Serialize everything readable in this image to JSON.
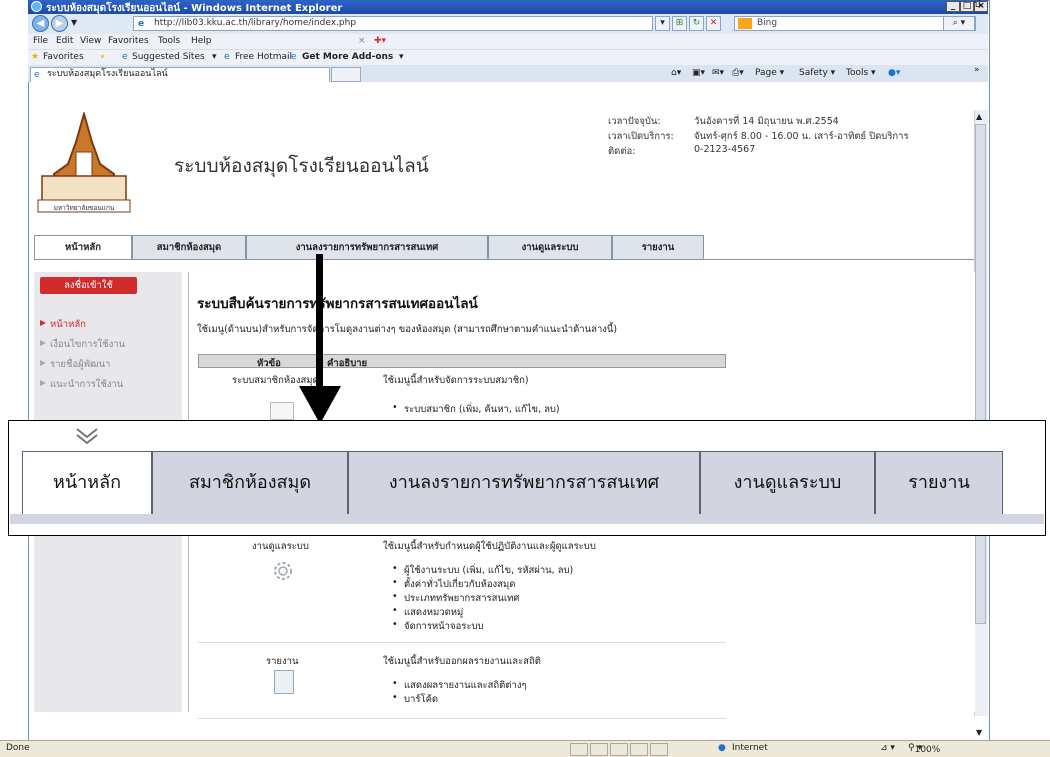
{
  "window": {
    "title": "ระบบห้องสมุดโรงเรียนออนไลน์ - Windows Internet Explorer",
    "url": "http://lib03.kku.ac.th/library/home/index.php",
    "search_placeholder": "Bing",
    "corner_mark": "ป",
    "min": "_",
    "max": "□",
    "close": "×"
  },
  "menu": [
    "File",
    "Edit",
    "View",
    "Favorites",
    "Tools",
    "Help"
  ],
  "favorites_bar": {
    "favorites": "Favorites",
    "suggested": "Suggested Sites",
    "hotmail": "Free Hotmail",
    "addons": "Get More Add-ons"
  },
  "tab": {
    "label": "ระบบห้องสมุดโรงเรียนออนไลน์"
  },
  "toolbar": {
    "page": "Page",
    "safety": "Safety",
    "tools": "Tools",
    "more": "»"
  },
  "header": {
    "site_title": "ระบบห้องสมุดโรงเรียนออนไลน์",
    "logo_caption": "มหาวิทยาลัยขอนแก่น",
    "info": [
      {
        "label": "เวลาปัจจุบัน:",
        "value": "วันอังคารที่ 14 มิถุนายน พ.ศ.2554"
      },
      {
        "label": "เวลาเปิดบริการ:",
        "value": "จันทร์-ศุกร์ 8.00 - 16.00 น. เสาร์-อาทิตย์ ปิดบริการ"
      },
      {
        "label": "ติดต่อ:",
        "value": "0-2123-4567"
      }
    ]
  },
  "main_tabs": [
    "หน้าหลัก",
    "สมาชิกห้องสมุด",
    "งานลงรายการทรัพยากรสารสนเทศ",
    "งานดูแลระบบ",
    "รายงาน"
  ],
  "sidebar": {
    "login": "ลงชื่อเข้าใช้",
    "items": [
      "หน้าหลัก",
      "เงื่อนไขการใช้งาน",
      "รายชื่อผู้พัฒนา",
      "แนะนำการใช้งาน"
    ]
  },
  "content": {
    "heading": "ระบบสืบค้นรายการทรัพยากรสารสนเทศออนไลน์",
    "description": "ใช้เมนู(ด้านบน)สำหรับการจัดการโมดูลงานต่างๆ ของห้องสมุด (สามารถศึกษาตามคำแนะนำด้านล่างนี้)",
    "col_topic": "หัวข้อ",
    "col_desc": "คำอธิบาย",
    "row1": {
      "topic": "ระบบสมาชิกห้องสมุด",
      "desc": "ใช้เมนูนี้สำหรับจัดการระบบสมาชิก)",
      "bullets": [
        "ระบบสมาชิก (เพิ่ม, ค้นหา, แก้ไข, ลบ)"
      ]
    },
    "row_admin": {
      "topic": "งานดูแลระบบ",
      "desc": "ใช้เมนูนี้สำหรับกำหนดผู้ใช้ปฏิบัติงานและผู้ดูแลระบบ",
      "bullets": [
        "ผู้ใช้งานระบบ (เพิ่ม, แก้ไข, รหัสผ่าน, ลบ)",
        "ตั้งค่าทั่วไปเกี่ยวกับห้องสมุด",
        "ประเภททรัพยากรสารสนเทศ",
        "แสดงหมวดหมู่",
        "จัดการหน้าจอระบบ"
      ]
    },
    "row_report": {
      "topic": "รายงาน",
      "desc": "ใช้เมนูนี้สำหรับออกผลรายงานและสถิติ",
      "bullets": [
        "แสดงผลรายงานและสถิติต่างๆ",
        "บาร์โค้ด"
      ]
    }
  },
  "status": {
    "left": "Done",
    "zone": "Internet",
    "zoom": "100%"
  }
}
